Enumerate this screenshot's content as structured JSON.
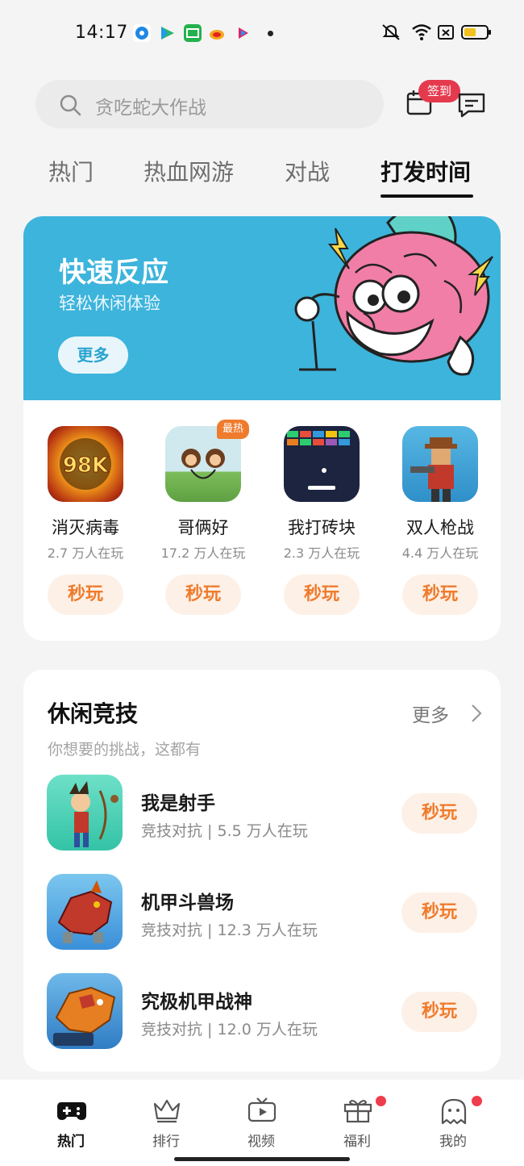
{
  "status_bar": {
    "time": "14:17"
  },
  "search": {
    "placeholder": "贪吃蛇大作战"
  },
  "header": {
    "sign_badge": "签到"
  },
  "tabs": [
    {
      "label": "热门",
      "active": false
    },
    {
      "label": "热血网游",
      "active": false
    },
    {
      "label": "对战",
      "active": false
    },
    {
      "label": "打发时间",
      "active": true
    }
  ],
  "banner": {
    "title": "快速反应",
    "subtitle": "轻松休闲体验",
    "more_label": "更多"
  },
  "banner_games": [
    {
      "name": "消灭病毒",
      "plays": "2.7 万人在玩",
      "play_label": "秒玩",
      "badge": "",
      "icon_text": "98K"
    },
    {
      "name": "哥俩好",
      "plays": "17.2 万人在玩",
      "play_label": "秒玩",
      "badge": "最热"
    },
    {
      "name": "我打砖块",
      "plays": "2.3 万人在玩",
      "play_label": "秒玩",
      "badge": ""
    },
    {
      "name": "双人枪战",
      "plays": "4.4 万人在玩",
      "play_label": "秒玩",
      "badge": ""
    }
  ],
  "casual": {
    "title": "休闲竞技",
    "subtitle": "你想要的挑战，这都有",
    "more_label": "更多",
    "items": [
      {
        "name": "我是射手",
        "meta": "竞技对抗 | 5.5 万人在玩",
        "play_label": "秒玩"
      },
      {
        "name": "机甲斗兽场",
        "meta": "竞技对抗 | 12.3 万人在玩",
        "play_label": "秒玩"
      },
      {
        "name": "究极机甲战神",
        "meta": "竞技对抗 | 12.0 万人在玩",
        "play_label": "秒玩"
      }
    ]
  },
  "bottom_nav": [
    {
      "label": "热门",
      "icon": "gamepad-icon",
      "active": true,
      "dot": false
    },
    {
      "label": "排行",
      "icon": "crown-icon",
      "active": false,
      "dot": false
    },
    {
      "label": "视频",
      "icon": "tv-icon",
      "active": false,
      "dot": false
    },
    {
      "label": "福利",
      "icon": "gift-icon",
      "active": false,
      "dot": true
    },
    {
      "label": "我的",
      "icon": "ghost-icon",
      "active": false,
      "dot": true
    }
  ],
  "colors": {
    "accent_orange": "#ef7b2c",
    "banner_blue": "#3db4dc",
    "badge_red": "#e53a4d"
  }
}
